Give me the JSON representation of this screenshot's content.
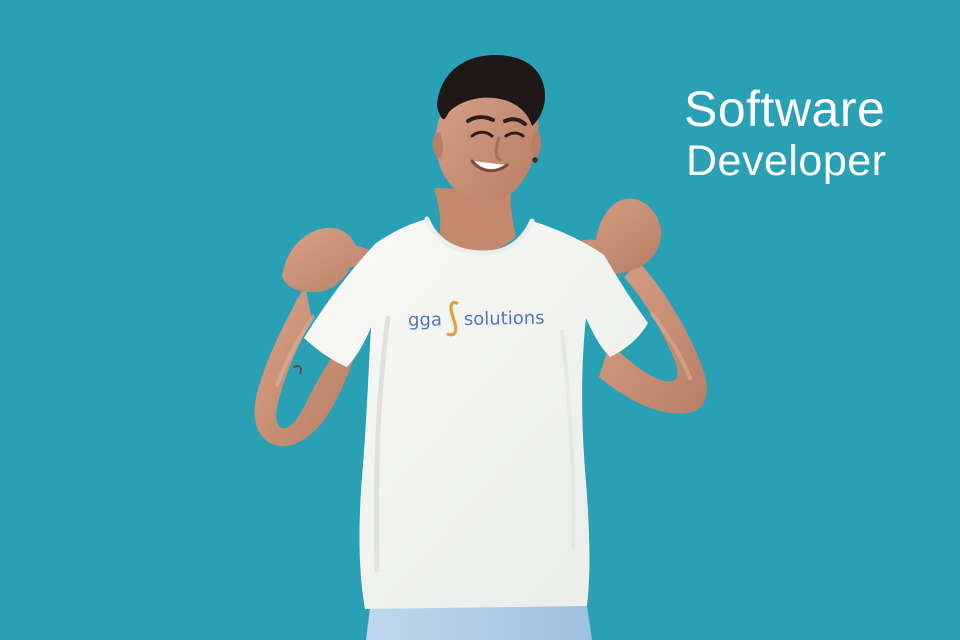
{
  "headline": {
    "line_1": "Software",
    "line_2": "Developer"
  },
  "shirt_logo": {
    "part_1": "gga",
    "part_2": "solutions"
  },
  "colors": {
    "background": "#2aa0b4",
    "headline_text": "#ffffff",
    "logo_blue": "#4d79b8",
    "logo_orange": "#e3a13b",
    "shirt": "#f7f7f5",
    "skin": "#c9957c",
    "hair": "#1e1918"
  },
  "icons": {
    "logo_mark": "integral-symbol"
  }
}
